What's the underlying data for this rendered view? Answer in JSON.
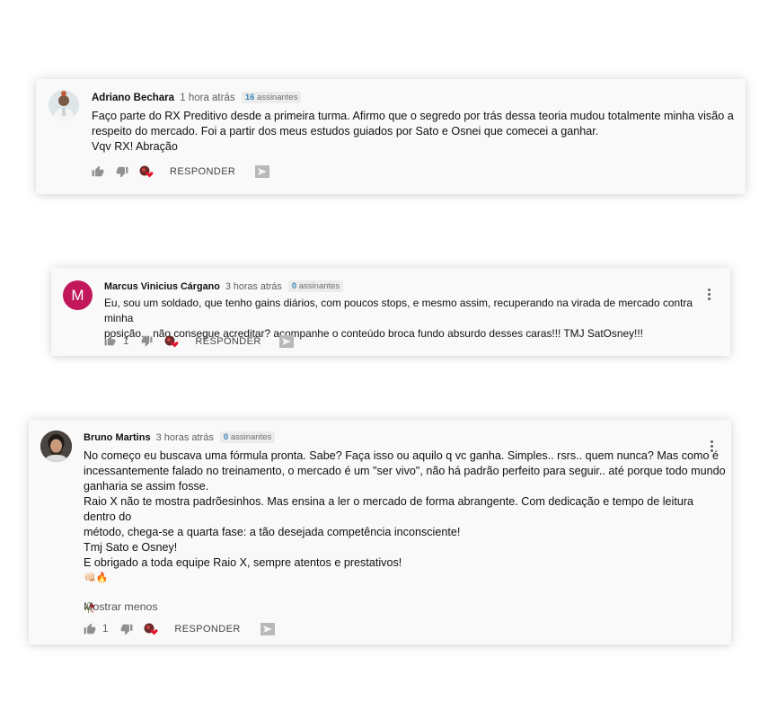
{
  "comments": [
    {
      "author": "Adriano Bechara",
      "time": "1 hora atrás",
      "subscribers_count": "16",
      "subscribers_label": "assinantes",
      "text": [
        "Faço parte do RX Preditivo desde a primeira turma. Afirmo que o segredo por trás dessa teoria mudou totalmente minha visão a",
        "respeito do mercado. Foi a partir dos meus estudos guiados por Sato e Osnei que comecei a ganhar.",
        "Vqv RX! Abração"
      ],
      "likes": "",
      "reply_label": "RESPONDER"
    },
    {
      "author": "Marcus Vinicius Cárgano",
      "avatar_letter": "M",
      "avatar_color": "#c2185b",
      "time": "3 horas atrás",
      "subscribers_count": "0",
      "subscribers_label": "assinantes",
      "text": [
        "Eu, sou um soldado, que tenho gains diários, com poucos stops, e mesmo assim, recuperando na virada de mercado contra minha",
        "posição... não consegue acreditar? acompanhe o conteúdo broca fundo absurdo desses caras!!! TMJ SatOsney!!!"
      ],
      "likes": "1",
      "reply_label": "RESPONDER"
    },
    {
      "author": "Bruno Martins",
      "time": "3 horas atrás",
      "subscribers_count": "0",
      "subscribers_label": "assinantes",
      "text": [
        "No começo eu buscava uma fórmula pronta. Sabe? Faça isso ou aquilo q vc ganha. Simples.. rsrs.. quem nunca? Mas como é",
        "incessantemente falado no treinamento, o mercado é um \"ser vivo\", não há padrão perfeito para seguir.. até porque todo mundo",
        "ganharia se assim fosse.",
        "Raio X não te mostra padrõesinhos. Mas ensina a ler o mercado de forma abrangente. Com dedicação e tempo de leitura dentro do",
        "método, chega-se a quarta fase: a tão desejada competência inconsciente!",
        "Tmj Sato e Osney!",
        "E obrigado a toda equipe Raio X, sempre atentos e prestativos!",
        "👊🏻🔥",
        "",
        "🥀"
      ],
      "show_less": "Mostrar menos",
      "likes": "1",
      "reply_label": "RESPONDER"
    }
  ],
  "colors": {
    "card_bg": "#f9f9f9",
    "subs_count": "#3a87b8",
    "icon_gray": "#909090",
    "heart_red": "#e0162b"
  }
}
